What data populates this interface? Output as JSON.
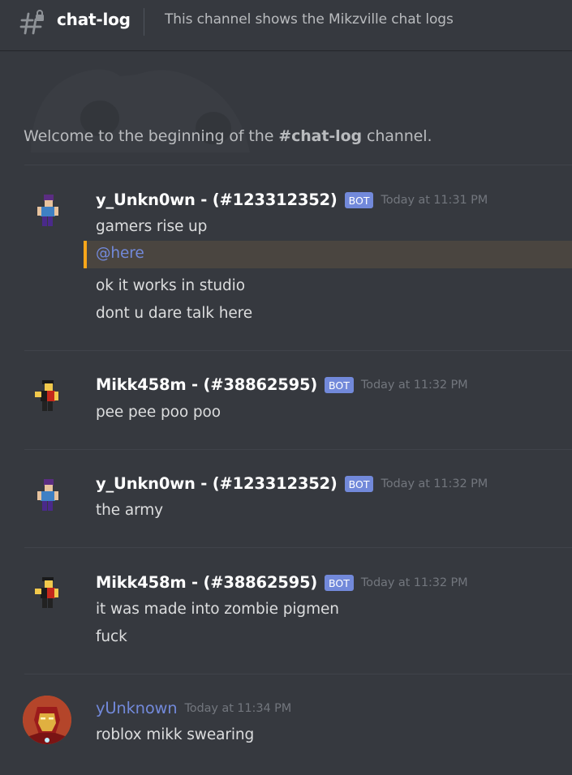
{
  "header": {
    "channel_name": "chat-log",
    "topic": "This channel shows the Mikzville chat logs"
  },
  "welcome": {
    "prefix": "Welcome to the beginning of the ",
    "channel": "#chat-log",
    "suffix": " channel."
  },
  "colors": {
    "background": "#36393f",
    "bot_badge": "#7289da",
    "mention_bar": "#faa61a",
    "mention_text": "#7289da"
  },
  "messages": [
    {
      "author": "y_Unkn0wn - (#123312352)",
      "badge": "BOT",
      "time": "Today at 11:31 PM",
      "avatar": "roblox-purple-avatar-icon",
      "lines": [
        "gamers rise up",
        "ok it works in studio",
        "dont u dare talk here"
      ],
      "mention": "@here"
    },
    {
      "author": "Mikk458m - (#38862595)",
      "badge": "BOT",
      "time": "Today at 11:32 PM",
      "avatar": "roblox-red-avatar-icon",
      "lines": [
        "pee pee poo poo"
      ]
    },
    {
      "author": "y_Unkn0wn - (#123312352)",
      "badge": "BOT",
      "time": "Today at 11:32 PM",
      "avatar": "roblox-purple-avatar-icon",
      "lines": [
        "the army"
      ]
    },
    {
      "author": "Mikk458m - (#38862595)",
      "badge": "BOT",
      "time": "Today at 11:32 PM",
      "avatar": "roblox-red-avatar-icon",
      "lines": [
        "it was made into zombie pigmen",
        "fuck"
      ]
    },
    {
      "author": "yUnknown",
      "time": "Today at 11:34 PM",
      "avatar": "ironman-avatar-icon",
      "lines": [
        "roblox mikk swearing"
      ]
    }
  ]
}
